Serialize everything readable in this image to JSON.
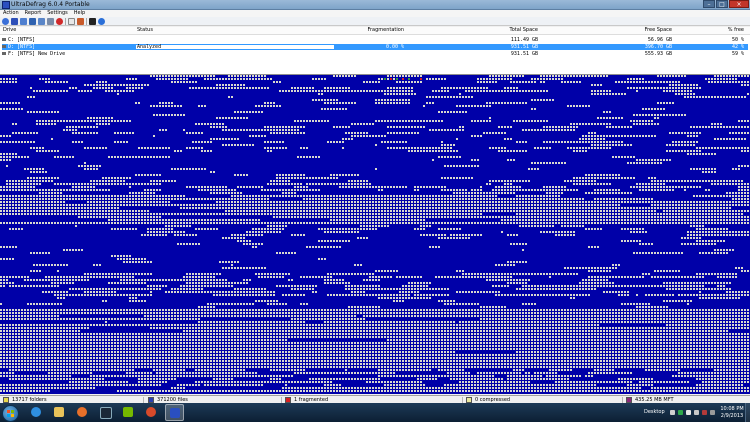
{
  "window": {
    "title": "UltraDefrag 6.0.4 Portable"
  },
  "menu": [
    "Action",
    "Report",
    "Settings",
    "Help"
  ],
  "toolbar": [
    "analyze-icon",
    "defragment-icon",
    "quick-optimize-icon",
    "full-optimize-icon",
    "mft-optimize-icon",
    "pause-icon",
    "stop-icon",
    "report-icon",
    "settings-icon",
    "boot-time-icon",
    "help-icon"
  ],
  "columns": {
    "drive": "Drive",
    "status": "Status",
    "fragmentation": "Fragmentation",
    "total": "Total Space",
    "free": "Free Space",
    "pct": "% free"
  },
  "volumes": [
    {
      "drive": "C: [NTFS]",
      "status": "",
      "fragmentation": "",
      "total": "111.49 GB",
      "free": "56.96 GB",
      "pct": "50 %",
      "selected": false
    },
    {
      "drive": "D: [NTFS]",
      "status": "Analyzed",
      "fragmentation": "0.00 %",
      "total": "931.51 GB",
      "free": "396.70 GB",
      "pct": "42 %",
      "selected": true
    },
    {
      "drive": "F: [NTFS]   New Drive",
      "status": "",
      "fragmentation": "",
      "total": "931.51 GB",
      "free": "555.93 GB",
      "pct": "59 %",
      "selected": false
    }
  ],
  "cluster_map": {
    "free_color": "#0000a8",
    "used_color": "#d9d9d0",
    "fragmented_color": "#d92020",
    "mft_color": "#3a9a3a"
  },
  "status": {
    "folders": "13717 folders",
    "files": "371200 files",
    "fragmented": "1 fragmented",
    "compressed": "0 compressed",
    "mft": "435.25 MB MFT"
  },
  "taskbar": {
    "apps": [
      "internet-explorer-icon",
      "file-explorer-icon",
      "firefox-icon",
      "steam-icon",
      "nvidia-icon",
      "media-player-icon",
      "ultradefrag-icon"
    ],
    "desktop_label": "Desktop",
    "time": "10:08 PM",
    "date": "2/9/2013"
  },
  "window_buttons": {
    "minimize": "–",
    "maximize": "□",
    "close": "×"
  }
}
